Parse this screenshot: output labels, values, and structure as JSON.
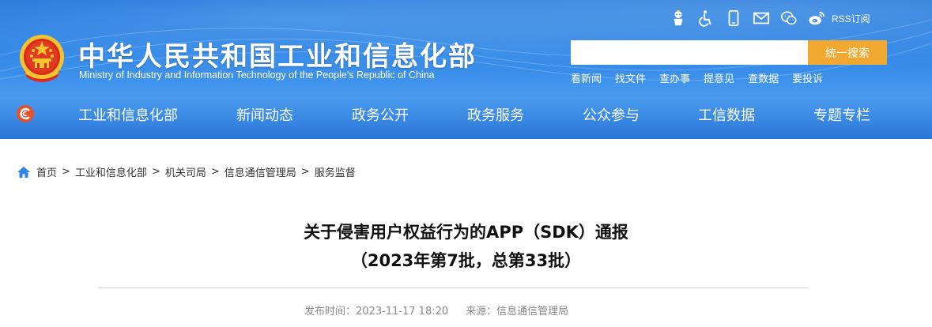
{
  "header": {
    "title_cn": "中华人民共和国工业和信息化部",
    "title_en": "Ministry of Industry and Information Technology of the People's Republic of China",
    "rss_label": "RSS订阅",
    "top_icons": [
      "accessibility-robot-icon",
      "wheelchair-icon",
      "mobile-icon",
      "mail-icon",
      "wechat-icon",
      "weibo-icon"
    ]
  },
  "search": {
    "placeholder": "",
    "button_label": "统一搜索"
  },
  "quick_links": [
    "看新闻",
    "找文件",
    "查办事",
    "提意见",
    "查数据",
    "要投诉"
  ],
  "nav": {
    "items": [
      "工业和信息化部",
      "新闻动态",
      "政务公开",
      "政务服务",
      "公众参与",
      "工信数据",
      "专题专栏"
    ]
  },
  "breadcrumb": [
    "首页",
    "工业和信息化部",
    "机关司局",
    "信息通信管理局",
    "服务监督"
  ],
  "article": {
    "title": "关于侵害用户权益行为的APP（SDK）通报",
    "subtitle": "（2023年第7批，总第33批）",
    "publish_label": "发布时间：2023-11-17 18:20",
    "source_label": "来源：信息通信管理局"
  },
  "colors": {
    "header_blue": "#2f86e6",
    "search_button": "#f0a830"
  }
}
